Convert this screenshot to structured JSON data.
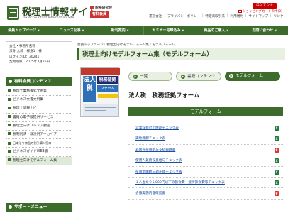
{
  "header": {
    "site_title": "税理士情報サイト",
    "site_subtitle": "Tax Accountant Information Site",
    "publisher": "税務研究会",
    "paid_badge": "有料会員",
    "login_label": "ログアウト",
    "cart_label": "ショッピングカートの中(0)",
    "top_links": [
      "運営会社",
      "プライバシーポリシー",
      "特定商取引法",
      "利用規約",
      "サイトマップ",
      "リンク"
    ]
  },
  "nav": {
    "items": [
      "会員トップページ",
      "ニュース記事",
      "新刊案内",
      "セミナー与申込み",
      "商品のご購入",
      "お問い合わせ"
    ]
  },
  "member": {
    "lines": [
      "会社・事務所名称",
      "法令 太郎　様身1　様",
      "ログインID：30241",
      "契約期限：2025年3月25日"
    ]
  },
  "sidebar": {
    "header": "有料会員コンテンツ",
    "items": [
      "税理士業務書式文例集",
      "ビジネス文書文例集",
      "税理士情報ナビ",
      "書籍の電子版提供サービス",
      "税理士向けプレミア動画",
      "税制判決・裁決例アーカイブ",
      "日本法令商品の割引購入窓口",
      "ビジネスガイドWEB版",
      "税理士向けモデルフォーム集"
    ],
    "support_header": "サポートメニュー"
  },
  "breadcrumb": "会員トップページ｜税理士向けモデルフォーム集｜モデルフォーム",
  "page_title": "税理士向けモデルフォーム集（モデルフォーム）",
  "book_cover": {
    "main_text": "法人税",
    "side_text": "税務証拠",
    "side_text2": "フォーム"
  },
  "tabs": [
    {
      "label": "一覧"
    },
    {
      "label": "書籍コンテンツ"
    },
    {
      "label": "モデルフォーム"
    }
  ],
  "book_title": "法人税　税務証拠フォーム",
  "forms_header": "モデルフォーム",
  "forms": [
    {
      "label": "営業収益計上時期チェック表",
      "type": "excel"
    },
    {
      "label": "実地棚卸チェック表",
      "type": "excel"
    },
    {
      "label": "非販売役員給与支払報酬書",
      "type": "pdf"
    },
    {
      "label": "使用人兼務役員給与チェック表",
      "type": "excel"
    },
    {
      "label": "役員退職給与適正額チェック表",
      "type": "excel"
    },
    {
      "label": "１人当たり5,000円以下の飲食費・接待飲食費等チェック表",
      "type": "excel"
    },
    {
      "label": "会議実施内容確認書",
      "type": "pdf"
    }
  ],
  "icon_names": {
    "excel": "excel-file-icon",
    "pdf": "pdf-file-icon"
  }
}
